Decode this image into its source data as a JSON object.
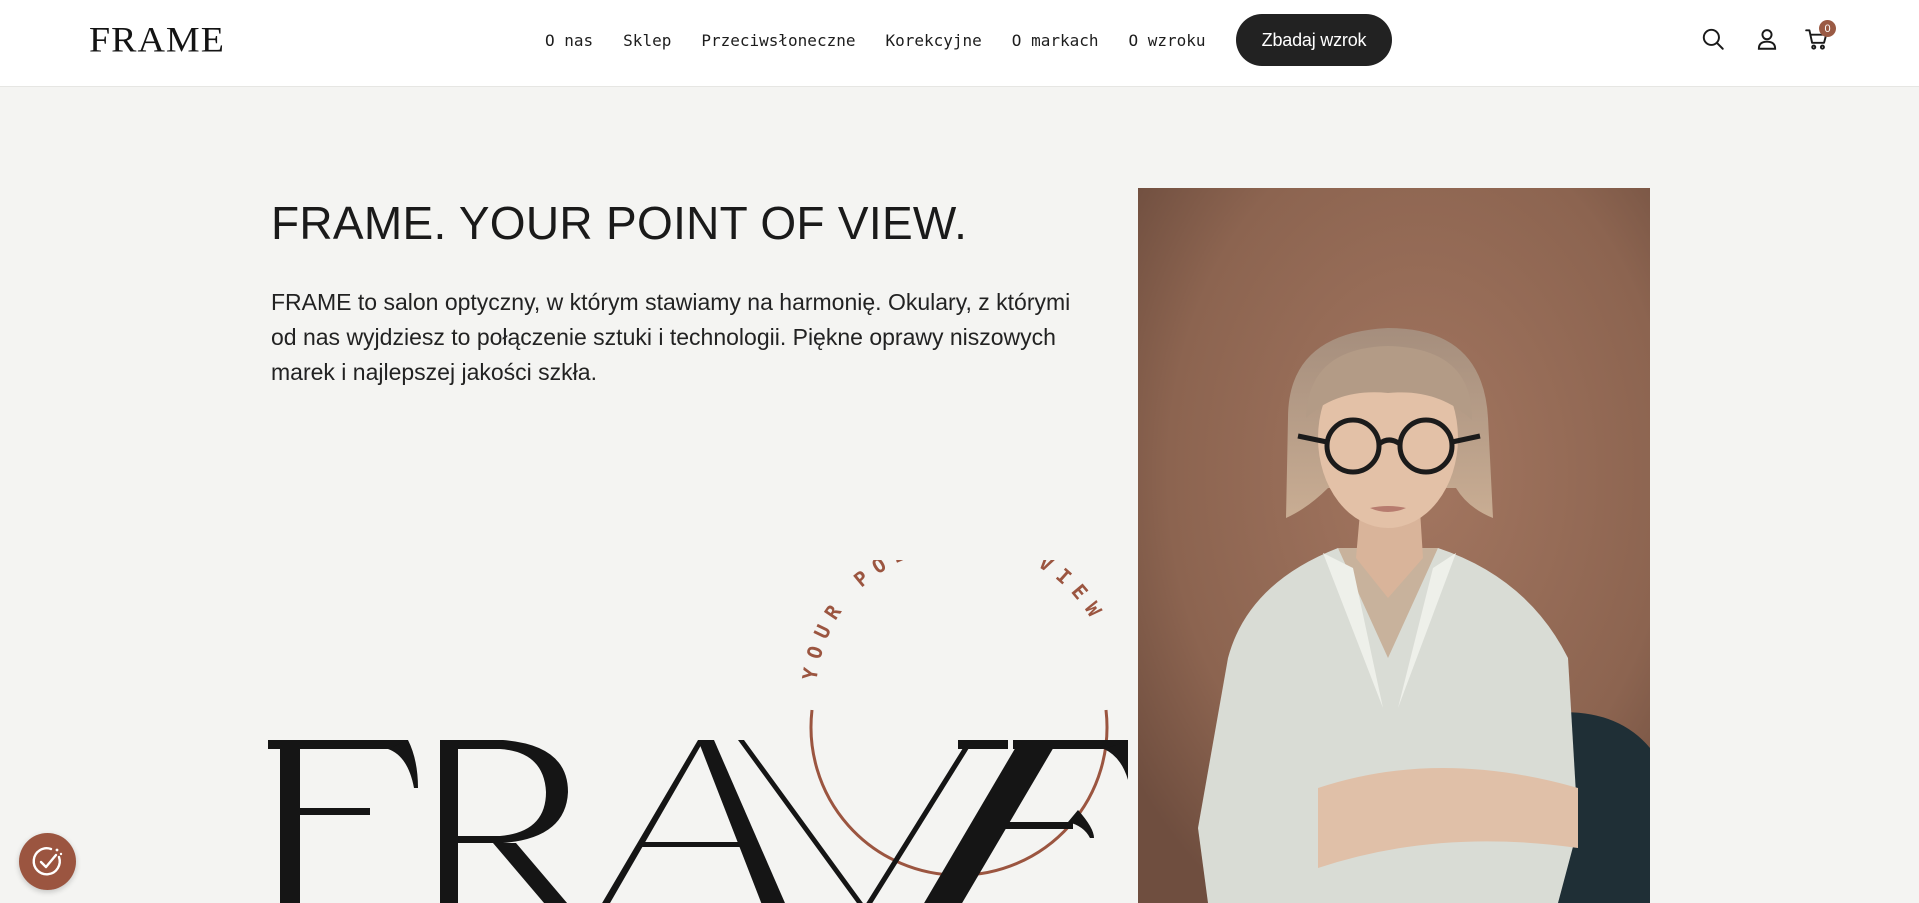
{
  "header": {
    "logo_text": "FRAME",
    "nav": [
      {
        "label": "O nas"
      },
      {
        "label": "Sklep"
      },
      {
        "label": "Przeciwsłoneczne"
      },
      {
        "label": "Korekcyjne"
      },
      {
        "label": "O markach"
      },
      {
        "label": "O wzroku"
      }
    ],
    "cta_label": "Zbadaj wzrok",
    "cart_count": "0",
    "icons": [
      "search-icon",
      "user-icon",
      "cart-icon"
    ]
  },
  "hero": {
    "title": "FRAME. YOUR POINT OF VIEW.",
    "text": "FRAME to salon optyczny, w którym stawiamy na harmonię. Okulary, z którymi od nas wyjdziesz to połączenie sztuki i technologii. Piękne oprawy niszowych marek i najlepszej jakości szkła."
  },
  "big_logo": {
    "wordmark": "FRAME",
    "circle_text": "YOUR POINT OF VIEW"
  },
  "colors": {
    "accent": "#9b5540",
    "dark": "#222222",
    "background": "#f4f4f2"
  }
}
